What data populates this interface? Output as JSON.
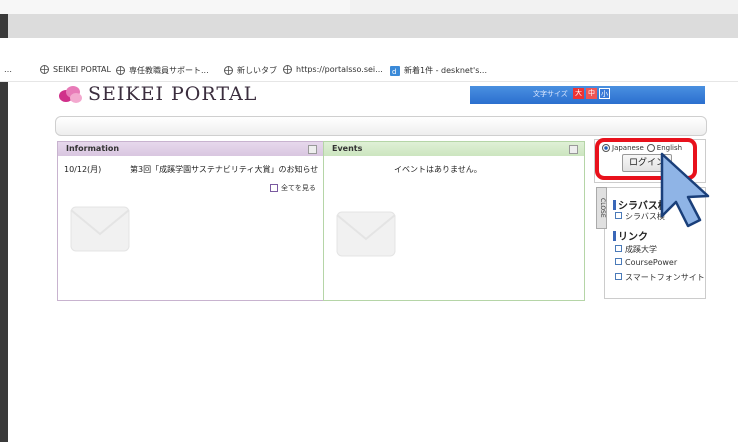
{
  "browser": {
    "bookmarks": [
      {
        "label": "SEIKEI PORTAL",
        "icon": "globe-icon"
      },
      {
        "label": "専任教職員サポート...",
        "icon": "globe-icon"
      },
      {
        "label": "新しいタブ",
        "icon": "globe-icon"
      },
      {
        "label": "https://portalsso.sei...",
        "icon": "globe-icon"
      },
      {
        "label": "新着1件 - desknet's...",
        "icon": "app-icon"
      }
    ]
  },
  "page": {
    "logo_text": "SEIKEI PORTAL",
    "font_size_label": "文字サイズ",
    "font_sizes": [
      "大",
      "中",
      "小"
    ],
    "information": {
      "title": "Information",
      "items": [
        {
          "date": "10/12(月)",
          "text": "第3回「成蹊学園サステナビリティ大賞」のお知らせ"
        }
      ],
      "see_all": "全てを見る"
    },
    "events": {
      "title": "Events",
      "empty_text": "イベントはありません。"
    },
    "login": {
      "lang_japanese": "Japanese",
      "lang_english": "English",
      "button": "ログイン"
    },
    "close_tab": "CLOSE",
    "syllabus": {
      "heading": "シラバス検",
      "item": "シラバス検"
    },
    "links": {
      "heading": "リンク",
      "items": [
        "成蹊大学",
        "CoursePower",
        "スマートフォンサイト"
      ]
    }
  },
  "colors": {
    "highlight": "#e8111c",
    "cursor": "#8fb4e6",
    "bluebar": "#2b6fcf"
  }
}
